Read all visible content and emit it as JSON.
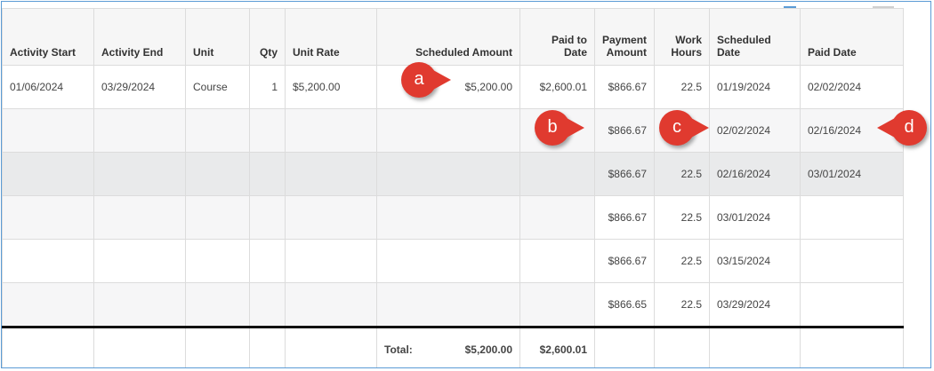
{
  "table": {
    "columns": [
      "Activity Start",
      "Activity End",
      "Unit",
      "Qty",
      "Unit Rate",
      "Scheduled Amount",
      "Paid to Date",
      "Payment Amount",
      "Work Hours",
      "Scheduled Date",
      "Paid Date"
    ],
    "main_row": {
      "activity_start": "01/06/2024",
      "activity_end": "03/29/2024",
      "unit": "Course",
      "qty": "1",
      "unit_rate": "$5,200.00",
      "scheduled_amount": "$5,200.00",
      "paid_to_date": "$2,600.01"
    },
    "payments": [
      {
        "amount": "$866.67",
        "hours": "22.5",
        "scheduled": "01/19/2024",
        "paid": "02/02/2024"
      },
      {
        "amount": "$866.67",
        "hours": "",
        "scheduled": "02/02/2024",
        "paid": "02/16/2024"
      },
      {
        "amount": "$866.67",
        "hours": "22.5",
        "scheduled": "02/16/2024",
        "paid": "03/01/2024"
      },
      {
        "amount": "$866.67",
        "hours": "22.5",
        "scheduled": "03/01/2024",
        "paid": ""
      },
      {
        "amount": "$866.67",
        "hours": "22.5",
        "scheduled": "03/15/2024",
        "paid": ""
      },
      {
        "amount": "$866.65",
        "hours": "22.5",
        "scheduled": "03/29/2024",
        "paid": ""
      }
    ],
    "total": {
      "label": "Total:",
      "scheduled_amount": "$5,200.00",
      "paid_to_date": "$2,600.01"
    }
  },
  "callouts": {
    "a": "a",
    "b": "b",
    "c": "c",
    "d": "d"
  },
  "colors": {
    "callout": "#e03a2f",
    "frame_border": "#5b9bd5",
    "total_border": "#111111"
  }
}
